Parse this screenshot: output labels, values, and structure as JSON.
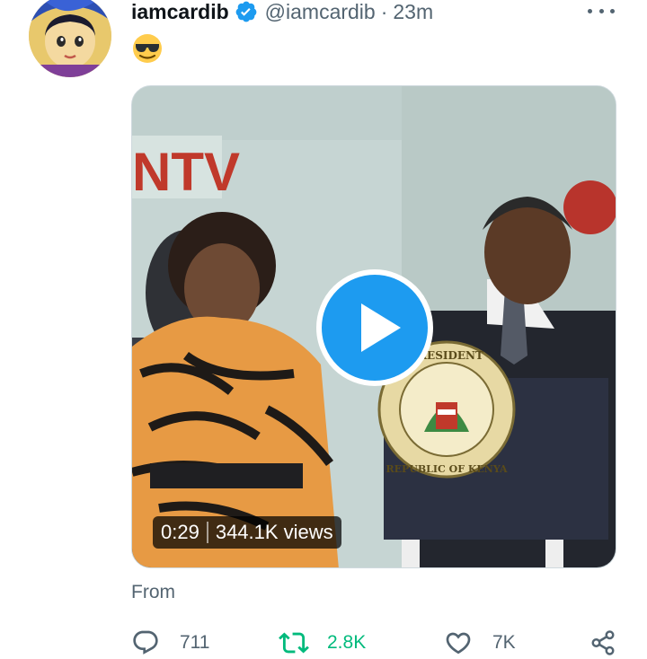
{
  "tweet": {
    "display_name": "iamcardib",
    "handle": "@iamcardib",
    "separator": "·",
    "time": "23m",
    "text_emoji": "smiling-face-with-sunglasses",
    "verified": true
  },
  "media": {
    "duration": "0:29",
    "views": "344.1K views",
    "logo_text": "NTV",
    "seal_top_text": "PRESIDENT",
    "seal_bottom_text": "REPUBLIC OF KENYA"
  },
  "source_label": "From",
  "actions": {
    "reply_count": "711",
    "retweet_count": "2.8K",
    "like_count": "7K"
  },
  "colors": {
    "accent_blue": "#1d9bf0",
    "retweet_green": "#00ba7c",
    "secondary_text": "#536471",
    "play_blue": "#1d9bf0"
  }
}
